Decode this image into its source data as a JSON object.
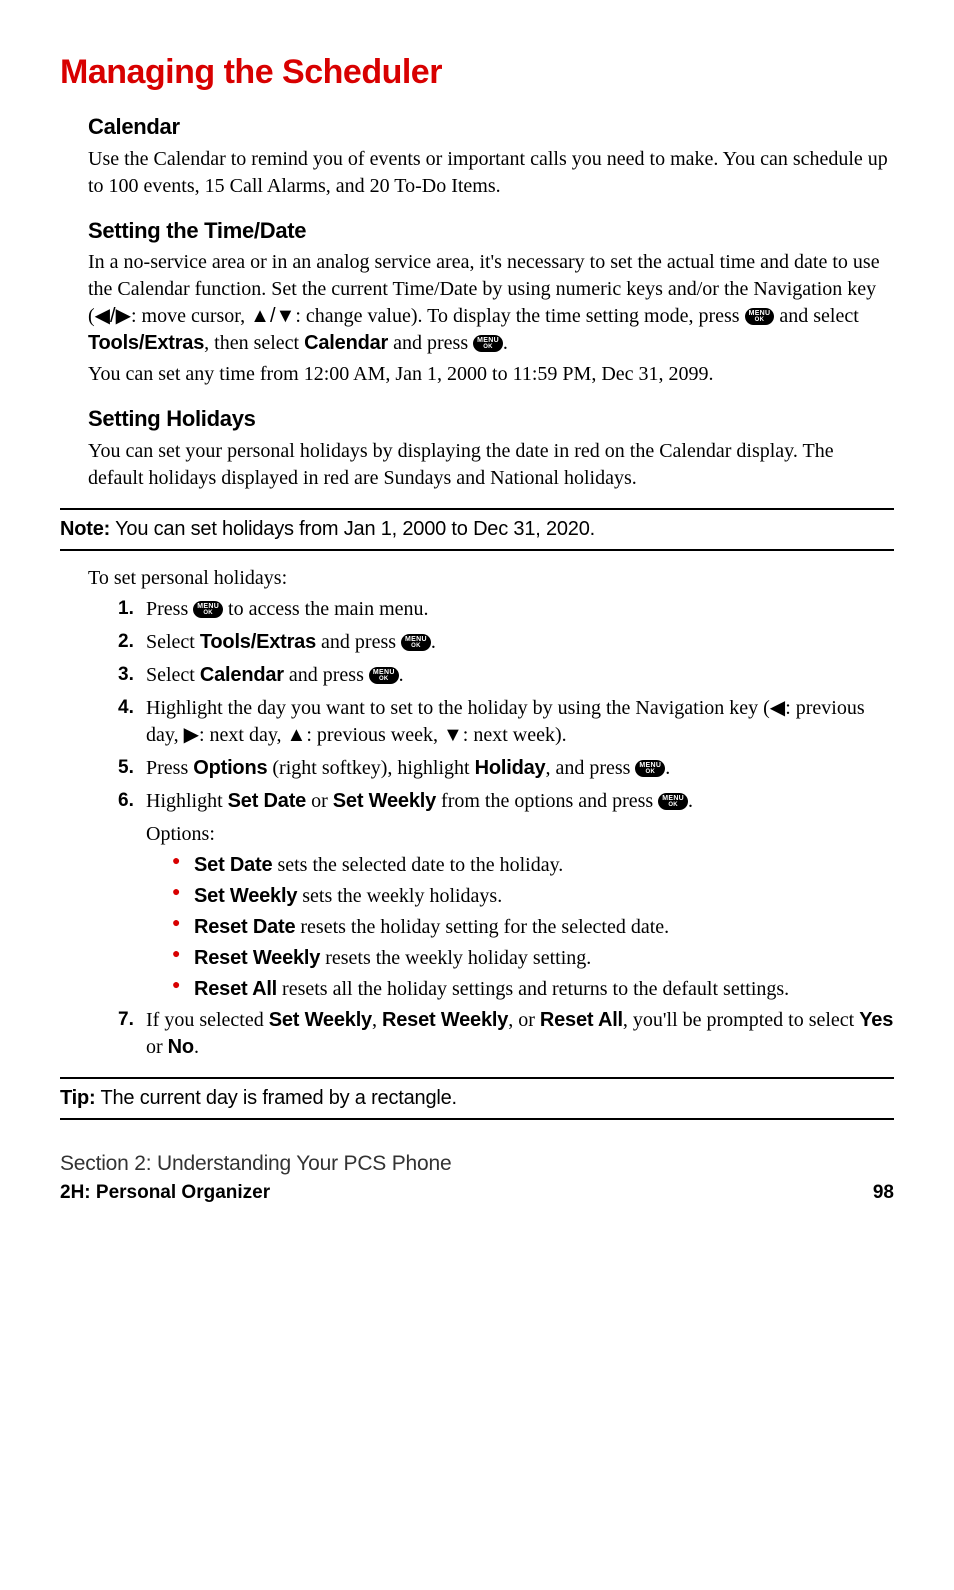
{
  "title": "Managing the Scheduler",
  "calendar": {
    "heading": "Calendar",
    "body": "Use the Calendar to remind you of events or important calls you need to make. You can schedule up to 100 events, 15 Call Alarms, and 20 To-Do Items."
  },
  "timedate": {
    "heading": "Setting the Time/Date",
    "p1a": "In a no-service area or in an analog service area, it's necessary to set the actual time and date to use the Calendar function. Set the current Time/Date by using numeric keys and/or the Navigation key (",
    "nav_lr": "◀/▶",
    "p1b": ": move cursor, ",
    "nav_ud": "▲/▼",
    "p1c": ": change value). To display the time setting mode, press ",
    "p1d": " and select ",
    "tools": "Tools/Extras",
    "p1e": ", then select ",
    "cal": "Calendar",
    "p1f": " and press ",
    "p1g": ".",
    "p2": "You can set any time from 12:00 AM, Jan 1, 2000 to 11:59 PM, Dec 31, 2099."
  },
  "holidays": {
    "heading": "Setting Holidays",
    "body": "You can set your personal holidays by displaying the date in red on the Calendar display. The default holidays displayed in red are Sundays and National holidays."
  },
  "note": {
    "label": "Note:",
    "text": " You can set holidays from Jan 1, 2000 to Dec 31, 2020."
  },
  "toset": "To set personal holidays:",
  "steps": {
    "s1a": "Press ",
    "s1b": " to access the main menu.",
    "s2a": "Select ",
    "s2_tools": "Tools/Extras",
    "s2b": " and press ",
    "s2c": ".",
    "s3a": "Select ",
    "s3_cal": "Calendar",
    "s3b": " and press ",
    "s3c": ".",
    "s4a": "Highlight the day you want to set to the holiday by using the Navigation key (",
    "s4_left": "◀",
    "s4b": ": previous day, ",
    "s4_right": "▶",
    "s4c": ": next day, ",
    "s4_up": "▲",
    "s4d": ": previous week, ",
    "s4_down": "▼",
    "s4e": ": next week).",
    "s5a": "Press ",
    "s5_opt": "Options",
    "s5b": " (right softkey), highlight ",
    "s5_hol": "Holiday",
    "s5c": ", and press ",
    "s5d": ".",
    "s6a": "Highlight ",
    "s6_sd": "Set Date",
    "s6b": " or ",
    "s6_sw": "Set Weekly",
    "s6c": " from the options and press ",
    "s6d": ".",
    "s7a": "If you selected ",
    "s7_sw": "Set Weekly",
    "s7b": ", ",
    "s7_rw": "Reset Weekly",
    "s7c": ", or ",
    "s7_ra": "Reset All",
    "s7d": ", you'll be prompted to select ",
    "s7_yes": "Yes",
    "s7e": " or ",
    "s7_no": "No",
    "s7f": "."
  },
  "options_label": "Options:",
  "options": {
    "o1_b": "Set Date",
    "o1_t": " sets the selected date to the holiday.",
    "o2_b": "Set Weekly",
    "o2_t": " sets the weekly holidays.",
    "o3_b": "Reset Date",
    "o3_t": " resets the holiday setting for the selected date.",
    "o4_b": "Reset Weekly",
    "o4_t": " resets the weekly holiday setting.",
    "o5_b": "Reset All",
    "o5_t": " resets all the holiday settings and returns to the default settings."
  },
  "tip": {
    "label": "Tip:",
    "text": " The current day is framed by a rectangle."
  },
  "footer": {
    "section": "Section 2: Understanding Your PCS Phone",
    "chapter": "2H: Personal Organizer",
    "page": "98"
  },
  "key": {
    "line1": "MENU",
    "line2": "OK"
  }
}
